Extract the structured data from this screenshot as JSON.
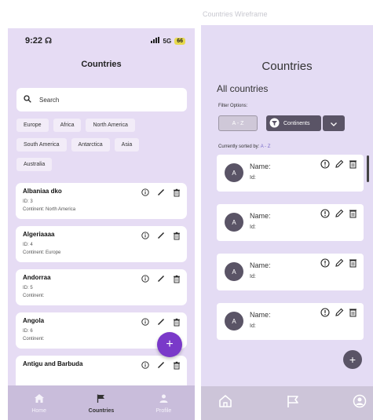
{
  "left": {
    "status": {
      "time": "9:22",
      "network": "5G",
      "battery": "66"
    },
    "title": "Countries",
    "search": {
      "placeholder": "Search"
    },
    "filters": {
      "row1": [
        "Europe",
        "Africa",
        "North America"
      ],
      "row2": [
        "South America",
        "Antarctica",
        "Asia"
      ],
      "row3": [
        "Australia"
      ]
    },
    "countries": [
      {
        "name": "Albaniaa dko",
        "id": "ID: 3",
        "continent": "Continent: North America"
      },
      {
        "name": "Algeriaaaa",
        "id": "ID: 4",
        "continent": "Continent: Europe"
      },
      {
        "name": "Andorraa",
        "id": "ID: 5",
        "continent": "Continent:"
      },
      {
        "name": "Angola",
        "id": "ID: 6",
        "continent": "Continent:"
      },
      {
        "name": "Antigu and Barbuda",
        "id": "",
        "continent": ""
      }
    ],
    "fab_label": "+",
    "nav": {
      "home": "Home",
      "countries": "Countries",
      "profile": "Profile"
    }
  },
  "right": {
    "caption": "Countries Wireframe",
    "title": "Countries",
    "subtitle": "All countries",
    "filter_label": "Filter Options:",
    "sort_button": "A - Z",
    "continents_button": "Continents",
    "sorted_prefix": "Currently sorted by:",
    "sorted_value": "A - Z",
    "cards": [
      {
        "avatar": "A",
        "name": "Name:",
        "id": "Id:"
      },
      {
        "avatar": "A",
        "name": "Name:",
        "id": "Id:"
      },
      {
        "avatar": "A",
        "name": "Name:",
        "id": "Id:"
      },
      {
        "avatar": "A",
        "name": "Name:",
        "id": "Id:"
      }
    ],
    "fab_label": "+"
  },
  "colors": {
    "lavender_bg": "#e6dcf4",
    "fab_purple": "#7a39c9",
    "nav_bar": "#c9bddb",
    "wireframe_dark": "#5a5466"
  }
}
